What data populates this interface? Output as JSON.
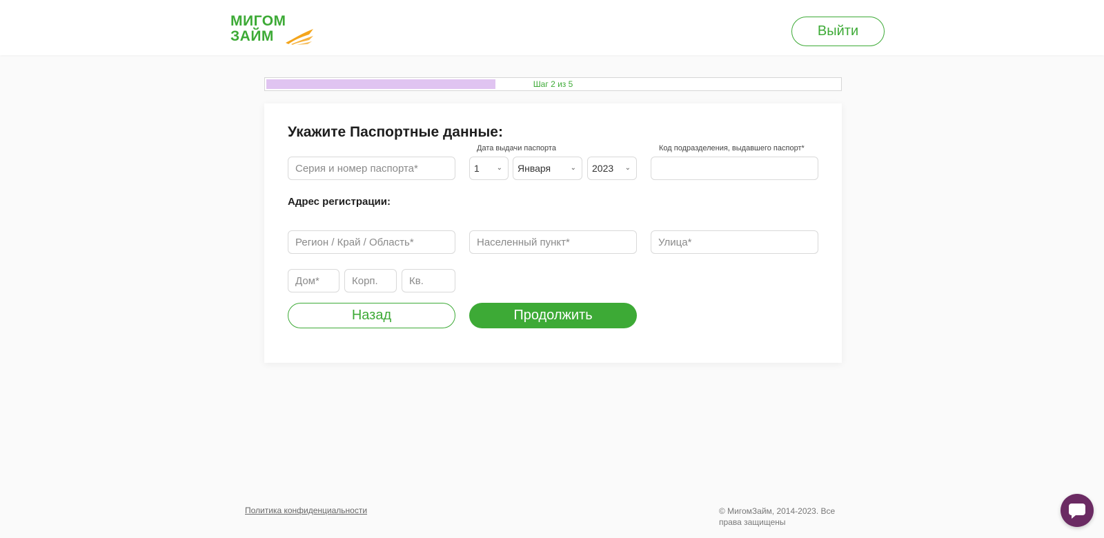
{
  "header": {
    "logo_line1": "МИГОМ",
    "logo_line2": "ЗАЙМ",
    "logout_label": "Выйти"
  },
  "progress": {
    "label": "Шаг 2 из 5",
    "fraction": 0.4,
    "fill_color": "#e0c4f1"
  },
  "form": {
    "title": "Укажите Паспортные данные:",
    "passport_number": {
      "placeholder": "Серия и номер паспорта*",
      "value": ""
    },
    "issue_date_label": "Дата выдачи паспорта",
    "issue_day": "1",
    "issue_month": "Января",
    "issue_year": "2023",
    "division_code_label": "Код подразделения, выдавшего паспорт*",
    "division_code": {
      "placeholder": "",
      "value": ""
    },
    "address_title": "Адрес регистрации:",
    "region": {
      "placeholder": "Регион / Край / Область*"
    },
    "city": {
      "placeholder": "Населенный пункт*"
    },
    "street": {
      "placeholder": "Улица*"
    },
    "house": {
      "placeholder": "Дом*"
    },
    "building": {
      "placeholder": "Корп."
    },
    "apartment": {
      "placeholder": "Кв."
    },
    "back_label": "Назад",
    "continue_label": "Продолжить"
  },
  "footer": {
    "privacy_link": "Политика конфиденциальности",
    "copyright": "© МигомЗайм, 2014-2023. Все права защищены"
  },
  "colors": {
    "brand_green": "#3daa36",
    "chat_button": "#6b2b63",
    "logo_accent": "#f4a51c"
  },
  "icons": {
    "chat": "chat-bubble-icon",
    "logo_swoosh": "swoosh-icon",
    "select_chevron": "chevron-down-icon"
  }
}
